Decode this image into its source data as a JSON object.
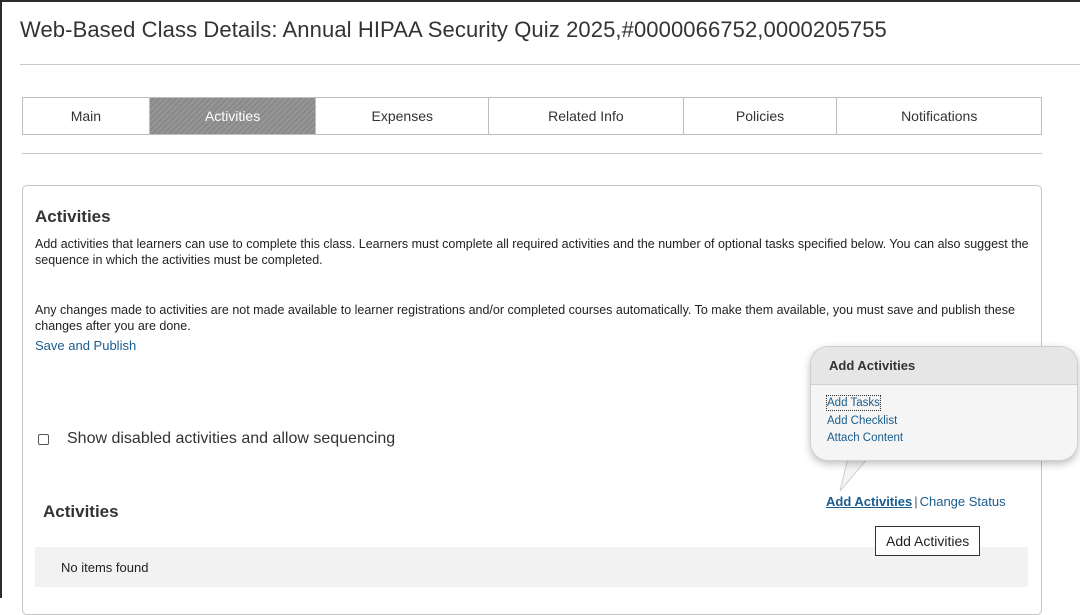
{
  "page": {
    "title": "Web-Based Class Details: Annual HIPAA Security Quiz 2025,#0000066752,0000205755"
  },
  "tabs": [
    {
      "label": "Main",
      "active": false
    },
    {
      "label": "Activities",
      "active": true
    },
    {
      "label": "Expenses",
      "active": false
    },
    {
      "label": "Related Info",
      "active": false
    },
    {
      "label": "Policies",
      "active": false
    },
    {
      "label": "Notifications",
      "active": false
    }
  ],
  "activities_section": {
    "heading": "Activities",
    "description_1": "Add activities that learners can use to complete this class. Learners must complete all required activities and the number of optional tasks specified below. You can also suggest the sequence in which the activities must be completed.",
    "description_2": "Any changes made to activities are not made available to learner registrations and/or completed courses automatically. To make them available, you must save and publish these changes after you are done.",
    "save_publish_link": "Save and Publish",
    "checkbox_label": "Show disabled activities and allow sequencing",
    "checkbox_checked": false
  },
  "activities_list": {
    "heading": "Activities",
    "add_activities_link": "Add Activities",
    "separator": "|",
    "change_status_link": "Change Status",
    "empty_message": "No items found",
    "tooltip": "Add Activities"
  },
  "popover": {
    "title": "Add Activities",
    "items": [
      "Add Tasks",
      "Add Checklist",
      "Attach Content"
    ]
  },
  "colors": {
    "link": "#1a5c8e",
    "active_tab": "#8f8f8f",
    "empty_row_bg": "#f2f2f2"
  }
}
